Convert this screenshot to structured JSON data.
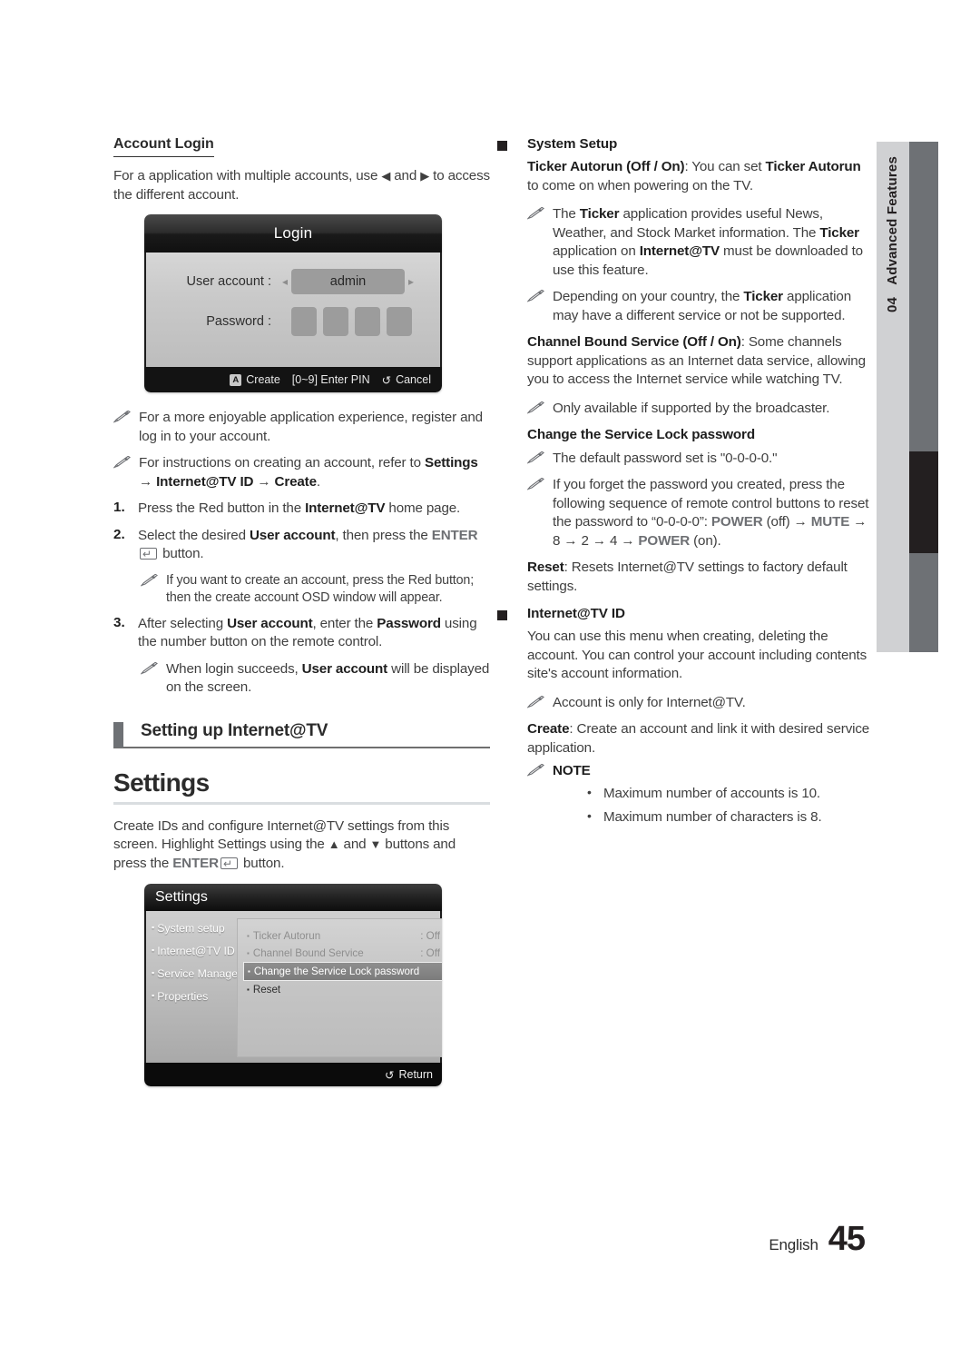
{
  "page": {
    "language": "English",
    "number": "45",
    "side_tab": {
      "chapter_number": "04",
      "chapter_title": "Advanced Features"
    }
  },
  "left_column": {
    "account_login": {
      "heading": "Account Login",
      "intro_1": "For a application with multiple  accounts, use ",
      "intro_arrow_left": "◀",
      "intro_2": " and ",
      "intro_arrow_right": "▶",
      "intro_3": " to access the different account."
    },
    "login_osd": {
      "title": "Login",
      "user_account_label": "User account :",
      "user_account_value": "admin",
      "password_label": "Password :",
      "password_dots_count": 4,
      "arrow_left": "◂",
      "arrow_right": "▸",
      "foot_create_key": "A",
      "foot_create_label": "Create",
      "foot_pin_label": "[0~9] Enter PIN",
      "foot_cancel_icon": "↺",
      "foot_cancel_label": "Cancel"
    },
    "notes": {
      "note_1": "For a more enjoyable application experience, register and log in to your account.",
      "note_2_a": "For instructions on creating an account, refer to ",
      "note_2_b": "Settings",
      "note_2_arrow1": " → ",
      "note_2_c": "Internet@TV ID",
      "note_2_arrow2": " → ",
      "note_2_d": "Create",
      "note_2_e": "."
    },
    "steps": [
      {
        "num": "1.",
        "text_a": "Press the Red button in the ",
        "bold_1": "Internet@TV",
        "text_b": " home page."
      },
      {
        "num": "2.",
        "text_a": "Select the desired ",
        "bold_1": "User account",
        "text_b": ", then press the ",
        "bold_2": "ENTER",
        "text_c": " button."
      },
      {
        "num": "3.",
        "text_a": "After selecting ",
        "bold_1": "User account",
        "text_b": ", enter the ",
        "bold_2": "Password",
        "text_c": " using the number button on the remote control."
      }
    ],
    "step_notes": {
      "after_step2": "If you want to create an account, press the Red button; then the create account OSD window will appear.",
      "after_step3_a": "When login succeeds, ",
      "after_step3_bold": "User account",
      "after_step3_b": " will be displayed on the screen."
    },
    "section_heading": "Setting up Internet@TV",
    "settings_heading": "Settings",
    "settings_intro_a": "Create IDs and configure Internet@TV settings from this screen. Highlight Settings using the ",
    "settings_arrow_up": "▲",
    "settings_intro_b": " and ",
    "settings_arrow_down": "▼",
    "settings_intro_c": " buttons and press the ",
    "settings_intro_enter": "ENTER",
    "settings_intro_d": " button.",
    "settings_osd": {
      "title": "Settings",
      "menu_items": [
        {
          "label": "System setup"
        },
        {
          "label": "Internet@TV ID"
        },
        {
          "label": "Service Manager"
        },
        {
          "label": "Properties"
        }
      ],
      "sub_items": [
        {
          "label": "Ticker Autorun",
          "value": ": Off",
          "selected": false,
          "dim": true
        },
        {
          "label": "Channel Bound Service",
          "value": ": Off",
          "selected": false,
          "dim": true
        },
        {
          "label": "Change the Service Lock password",
          "value": "",
          "selected": true,
          "dim": false
        },
        {
          "label": "Reset",
          "value": "",
          "selected": false,
          "dim": false
        }
      ],
      "foot_return_icon": "↺",
      "foot_return_label": "Return"
    }
  },
  "right_column": {
    "system_setup": {
      "heading": "System Setup",
      "ticker_bold": "Ticker Autorun (Off / On)",
      "ticker_text_a": ": You can set ",
      "ticker_bold_2": "Ticker Autorun",
      "ticker_text_b": " to come on when powering on the TV.",
      "note_1_a": "The ",
      "note_1_bold": "Ticker",
      "note_1_b": " application provides useful News, Weather, and Stock Market information. The ",
      "note_1_bold2": "Ticker",
      "note_1_c": " application on ",
      "note_1_bold3": "Internet@TV",
      "note_1_d": " must be downloaded to use this feature.",
      "note_2_a": "Depending on your country, the ",
      "note_2_bold": "Ticker",
      "note_2_b": " application may have a different service or not be supported.",
      "cbs_bold": "Channel Bound Service (Off / On)",
      "cbs_text": ": Some channels support applications as an Internet data service, allowing you to access the Internet service while watching TV.",
      "cbs_note": "Only available if supported by the broadcaster.",
      "lock_heading": "Change the Service Lock password",
      "lock_note_1": "The default password set is \"0-0-0-0.\"",
      "lock_note_2_a": "If you forget the password you created, press the following sequence of remote control buttons to reset the password to “0-0-0-0”: ",
      "lock_kw_power_off": "POWER",
      "lock_note_2_b": " (off) → ",
      "lock_kw_mute": "MUTE",
      "lock_note_2_c": " → 8 → 2 → 4 → ",
      "lock_kw_power_on": "POWER",
      "lock_note_2_d": " (on).",
      "reset_bold": "Reset",
      "reset_text": ": Resets Internet@TV settings to factory default settings."
    },
    "internet_tv_id": {
      "heading": "Internet@TV ID",
      "paragraph": "You can use this menu when creating, deleting the account. You can control your account including contents site's account information.",
      "note_1": "Account is only for Internet@TV.",
      "create_bold": "Create",
      "create_text": ": Create an account and link it with desired service application.",
      "note_heading": "NOTE",
      "bullets": [
        "Maximum number of accounts is 10.",
        "Maximum number of characters is 8."
      ]
    }
  }
}
